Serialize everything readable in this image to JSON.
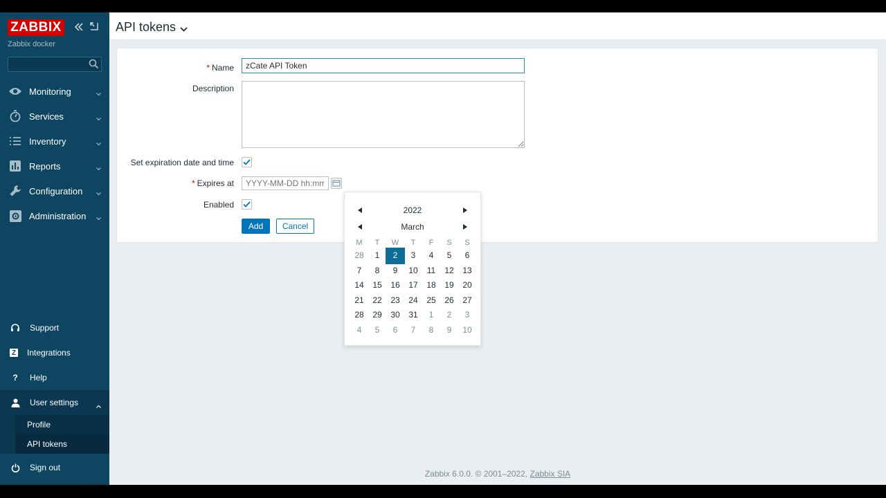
{
  "sidebar": {
    "logo": "ZABBIX",
    "server_name": "Zabbix docker",
    "search_placeholder": "",
    "menu": [
      {
        "label": "Monitoring",
        "icon": "eye-icon"
      },
      {
        "label": "Services",
        "icon": "stopwatch-icon"
      },
      {
        "label": "Inventory",
        "icon": "list-icon"
      },
      {
        "label": "Reports",
        "icon": "bar-chart-icon"
      },
      {
        "label": "Configuration",
        "icon": "wrench-icon"
      },
      {
        "label": "Administration",
        "icon": "gear-icon"
      }
    ],
    "bottom": {
      "support": "Support",
      "integrations": "Integrations",
      "integrations_glyph": "Z",
      "help": "Help",
      "help_glyph": "?",
      "user_settings": "User settings",
      "profile": "Profile",
      "api_tokens": "API tokens",
      "sign_out": "Sign out"
    }
  },
  "header": {
    "title": "API tokens"
  },
  "form": {
    "name_label": "Name",
    "name_value": "zCate API Token",
    "description_label": "Description",
    "description_value": "",
    "expiration_label": "Set expiration date and time",
    "expiration_checked": true,
    "expires_label": "Expires at",
    "expires_placeholder": "YYYY-MM-DD hh:mm:ss",
    "enabled_label": "Enabled",
    "enabled_checked": true,
    "add_label": "Add",
    "cancel_label": "Cancel"
  },
  "calendar": {
    "year": "2022",
    "month": "March",
    "weekdays": [
      "M",
      "T",
      "W",
      "T",
      "F",
      "S",
      "S"
    ],
    "weeks": [
      [
        "28",
        "1",
        "2",
        "3",
        "4",
        "5",
        "6"
      ],
      [
        "7",
        "8",
        "9",
        "10",
        "11",
        "12",
        "13"
      ],
      [
        "14",
        "15",
        "16",
        "17",
        "18",
        "19",
        "20"
      ],
      [
        "21",
        "22",
        "23",
        "24",
        "25",
        "26",
        "27"
      ],
      [
        "28",
        "29",
        "30",
        "31",
        "1",
        "2",
        "3"
      ],
      [
        "4",
        "5",
        "6",
        "7",
        "8",
        "9",
        "10"
      ]
    ],
    "selected": "2"
  },
  "footer": {
    "text": "Zabbix 6.0.0. © 2001–2022,",
    "link": "Zabbix SIA"
  },
  "colors": {
    "sidebar": "#0e4561",
    "logo": "#d40000",
    "primary": "#0275b8",
    "selected_day": "#0e6e98",
    "background": "#ebeef0"
  }
}
